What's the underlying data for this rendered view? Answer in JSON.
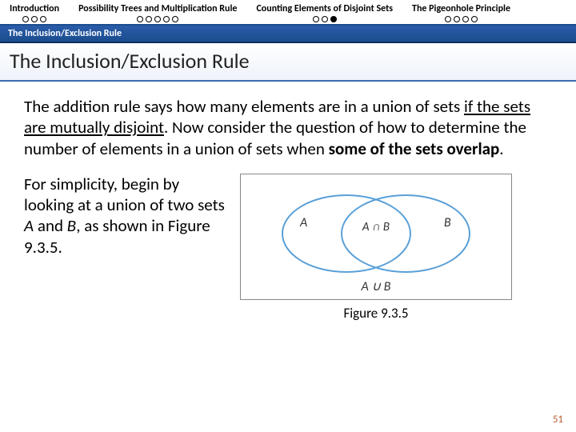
{
  "nav": {
    "items": [
      {
        "label": "Introduction",
        "dots": [
          "o",
          "o",
          "o"
        ]
      },
      {
        "label": "Possibility Trees and Multiplication Rule",
        "dots": [
          "o",
          "o",
          "o",
          "o",
          "o"
        ]
      },
      {
        "label": "Counting Elements of Disjoint Sets",
        "dots": [
          "o",
          "o",
          "f"
        ]
      },
      {
        "label": "The Pigeonhole Principle",
        "dots": [
          "o",
          "o",
          "o",
          "o"
        ]
      }
    ]
  },
  "section_label": "The Inclusion/Exclusion Rule",
  "title": "The Inclusion/Exclusion Rule",
  "para1_a": "The addition rule says how many elements are in a union of sets ",
  "para1_u": "if the sets are mutually disjoint",
  "para1_b": ". Now consider the question of how to determine the number of elements in a union of sets when ",
  "para1_bold": "some of the sets overlap",
  "para1_c": ".",
  "para2_a": "For simplicity, begin by looking at a union of two sets ",
  "para2_i1": "A",
  "para2_b": " and ",
  "para2_i2": "B",
  "para2_c": ", as shown in Figure 9.3.5.",
  "venn": {
    "A": "A",
    "B": "B",
    "inter": "A ∩ B",
    "union": "A ∪ B"
  },
  "caption": "Figure 9.3.5",
  "page": "51"
}
